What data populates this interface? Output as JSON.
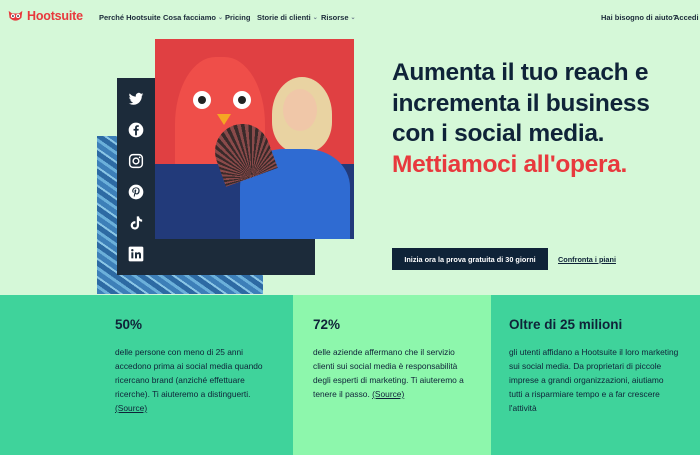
{
  "brand": {
    "name": "Hootsuite",
    "color": "#e8393d"
  },
  "nav": {
    "items": [
      {
        "label": "Perché Hootsuite",
        "dropdown": false
      },
      {
        "label": "Cosa facciamo",
        "dropdown": true
      },
      {
        "label": "Pricing",
        "dropdown": false
      },
      {
        "label": "Storie di clienti",
        "dropdown": true
      },
      {
        "label": "Risorse",
        "dropdown": true
      }
    ],
    "help": "Hai bisogno di aiuto?",
    "login": "Accedi"
  },
  "social_icons": [
    "twitter-icon",
    "facebook-icon",
    "instagram-icon",
    "pinterest-icon",
    "tiktok-icon",
    "linkedin-icon"
  ],
  "hero": {
    "headline": "Aumenta il tuo reach e incrementa il business con i social media.",
    "headline_accent": "Mettiamoci all'opera.",
    "cta": "Inizia ora la prova gratuita di 30 giorni",
    "plans_link": "Confronta i piani"
  },
  "stats": [
    {
      "value": "50%",
      "text": "delle persone con meno di 25 anni accedono prima ai social media quando ricercano brand (anziché effettuare ricerche). Ti aiuteremo a distinguerti.",
      "source": "(Source)"
    },
    {
      "value": "72%",
      "text": "delle aziende affermano che il servizio clienti sui social media è responsabilità degli esperti di marketing. Ti aiuteremo a tenere il passo.",
      "source": "(Source)"
    },
    {
      "value": "Oltre di 25 milioni",
      "text": "gli utenti affidano a Hootsuite il loro marketing sui social media. Da proprietari di piccole imprese a grandi organizzazioni, aiutiamo tutti a risparmiare tempo e a far crescere l'attività",
      "source": ""
    }
  ]
}
